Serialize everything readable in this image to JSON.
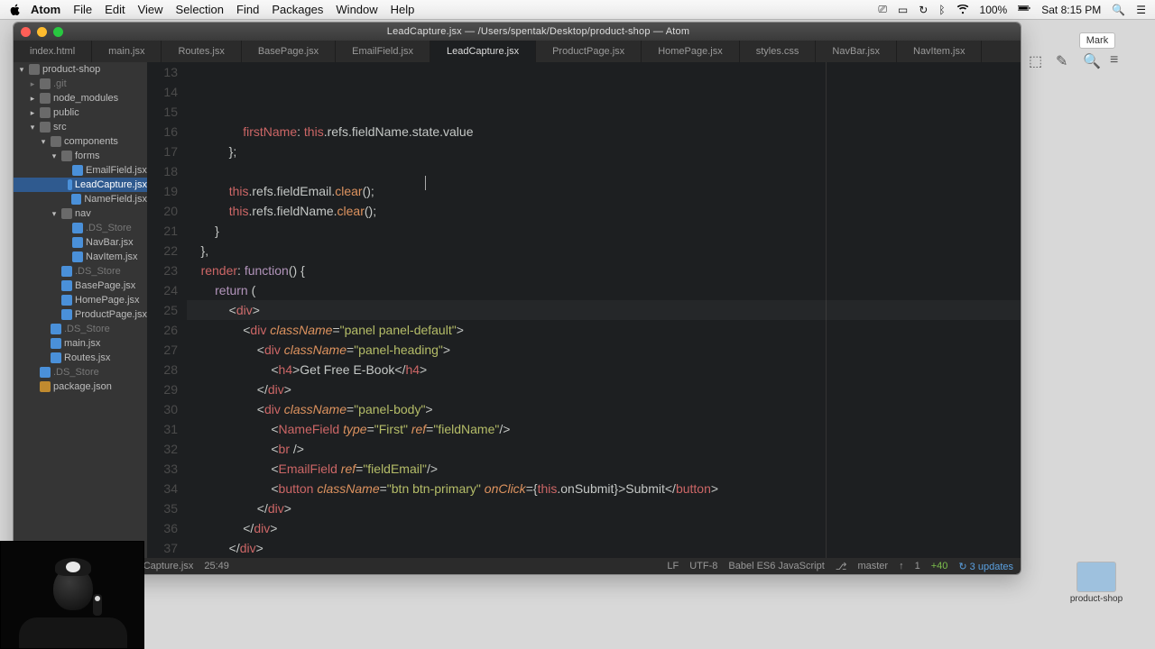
{
  "menubar": {
    "app": "Atom",
    "items": [
      "File",
      "Edit",
      "View",
      "Selection",
      "Find",
      "Packages",
      "Window",
      "Help"
    ],
    "battery": "100%",
    "clock": "Sat 8:15 PM"
  },
  "window": {
    "title": "LeadCapture.jsx — /Users/spentak/Desktop/product-shop — Atom"
  },
  "tabs": [
    {
      "label": "index.html"
    },
    {
      "label": "main.jsx"
    },
    {
      "label": "Routes.jsx"
    },
    {
      "label": "BasePage.jsx"
    },
    {
      "label": "EmailField.jsx"
    },
    {
      "label": "LeadCapture.jsx",
      "active": true
    },
    {
      "label": "ProductPage.jsx"
    },
    {
      "label": "HomePage.jsx"
    },
    {
      "label": "styles.css"
    },
    {
      "label": "NavBar.jsx"
    },
    {
      "label": "NavItem.jsx"
    }
  ],
  "tree": [
    {
      "d": 0,
      "open": true,
      "kind": "folder",
      "name": "product-shop"
    },
    {
      "d": 1,
      "open": false,
      "kind": "folder",
      "name": ".git",
      "dim": true
    },
    {
      "d": 1,
      "open": false,
      "kind": "folder",
      "name": "node_modules"
    },
    {
      "d": 1,
      "open": false,
      "kind": "folder",
      "name": "public"
    },
    {
      "d": 1,
      "open": true,
      "kind": "folder",
      "name": "src"
    },
    {
      "d": 2,
      "open": true,
      "kind": "folder",
      "name": "components"
    },
    {
      "d": 3,
      "open": true,
      "kind": "folder",
      "name": "forms"
    },
    {
      "d": 4,
      "kind": "file",
      "name": "EmailField.jsx"
    },
    {
      "d": 4,
      "kind": "file",
      "name": "LeadCapture.jsx",
      "selected": true
    },
    {
      "d": 4,
      "kind": "file",
      "name": "NameField.jsx"
    },
    {
      "d": 3,
      "open": true,
      "kind": "folder",
      "name": "nav"
    },
    {
      "d": 4,
      "kind": "file",
      "name": ".DS_Store",
      "dim": true
    },
    {
      "d": 4,
      "kind": "file",
      "name": "NavBar.jsx"
    },
    {
      "d": 4,
      "kind": "file",
      "name": "NavItem.jsx"
    },
    {
      "d": 3,
      "kind": "file",
      "name": ".DS_Store",
      "dim": true
    },
    {
      "d": 3,
      "kind": "file",
      "name": "BasePage.jsx"
    },
    {
      "d": 3,
      "kind": "file",
      "name": "HomePage.jsx"
    },
    {
      "d": 3,
      "kind": "file",
      "name": "ProductPage.jsx"
    },
    {
      "d": 2,
      "kind": "file",
      "name": ".DS_Store",
      "dim": true
    },
    {
      "d": 2,
      "kind": "file",
      "name": "main.jsx"
    },
    {
      "d": 2,
      "kind": "file",
      "name": "Routes.jsx"
    },
    {
      "d": 1,
      "kind": "file",
      "name": ".DS_Store",
      "dim": true
    },
    {
      "d": 1,
      "kind": "json",
      "name": "package.json"
    }
  ],
  "editor": {
    "firstLine": 13,
    "highlightLine": 25,
    "lines": [
      "                firstName: this.refs.fieldName.state.value",
      "            };",
      "",
      "            this.refs.fieldEmail.clear();",
      "            this.refs.fieldName.clear();",
      "        }",
      "    },",
      "    render: function() {",
      "        return (",
      "            <div>",
      "                <div className=\"panel panel-default\">",
      "                    <div className=\"panel-heading\">",
      "                        <h4>Get Free E-Book</h4>",
      "                    </div>",
      "                    <div className=\"panel-body\">",
      "                        <NameField type=\"First\" ref=\"fieldName\"/>",
      "                        <br />",
      "                        <EmailField ref=\"fieldEmail\"/>",
      "                        <button className=\"btn btn-primary\" onClick={this.onSubmit}>Submit</button>",
      "                    </div>",
      "                </div>",
      "            </div>",
      "        );",
      "    }",
      "});"
    ]
  },
  "status": {
    "path": "src/components/forms/LeadCapture.jsx",
    "cursor": "25:49",
    "eol": "LF",
    "encoding": "UTF-8",
    "grammar": "Babel ES6 JavaScript",
    "branch": "master",
    "g1": "1",
    "g2": "+40",
    "updates": "3 updates"
  },
  "mark_btn": "Mark",
  "desktop_label": "product-shop"
}
